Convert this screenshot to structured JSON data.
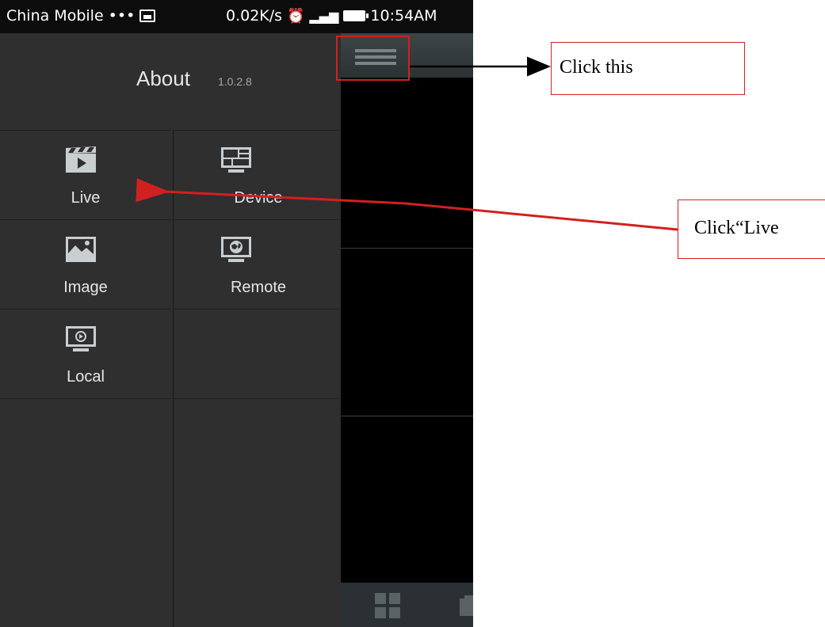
{
  "status_bar": {
    "carrier": "China Mobile •••",
    "speed": "0.02K/s",
    "time": "10:54AM"
  },
  "drawer": {
    "about_title": "About",
    "version": "1.0.2.8",
    "items": [
      {
        "label": "Live",
        "icon": "clapper-icon"
      },
      {
        "label": "Device",
        "icon": "monitor-grid-icon"
      },
      {
        "label": "Image",
        "icon": "image-icon"
      },
      {
        "label": "Remote",
        "icon": "remote-monitor-icon"
      },
      {
        "label": "Local",
        "icon": "local-video-icon"
      }
    ]
  },
  "annotations": {
    "click_this": "Click this",
    "click_live": "Click“Live"
  },
  "colors": {
    "annotation_red": "#d22020",
    "drawer_bg": "#2f2f2f"
  }
}
